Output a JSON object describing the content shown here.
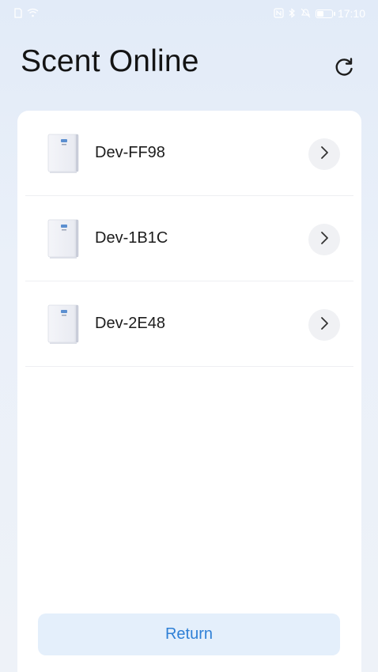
{
  "status_bar": {
    "time": "17:10",
    "battery_level": 0.5,
    "left_icons": [
      "sim-icon",
      "wifi-icon"
    ],
    "right_icons": [
      "nfc-icon",
      "bluetooth-icon",
      "mute-icon",
      "battery-icon"
    ]
  },
  "header": {
    "title": "Scent Online",
    "refresh_icon": "refresh-icon"
  },
  "devices": [
    {
      "name": "Dev-FF98",
      "icon": "scent-device-icon"
    },
    {
      "name": "Dev-1B1C",
      "icon": "scent-device-icon"
    },
    {
      "name": "Dev-2E48",
      "icon": "scent-device-icon"
    }
  ],
  "footer": {
    "return_label": "Return"
  },
  "colors": {
    "accent": "#2f80d6",
    "button_bg": "#e4effb",
    "card_bg": "#ffffff",
    "page_bg": "#e8eef8"
  }
}
